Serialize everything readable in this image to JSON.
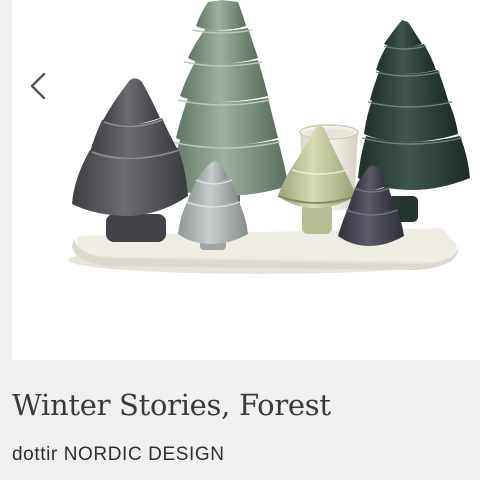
{
  "product": {
    "title": "Winter Stories, Forest",
    "brand": "dottir NORDIC DESIGN"
  },
  "gallery": {
    "image_icon": "ceramic-christmas-trees-image",
    "prev_icon": "chevron-left-icon"
  },
  "colors": {
    "page_background": "#f1f0ee",
    "image_background": "#ffffff",
    "text": "#3a3a3a"
  }
}
